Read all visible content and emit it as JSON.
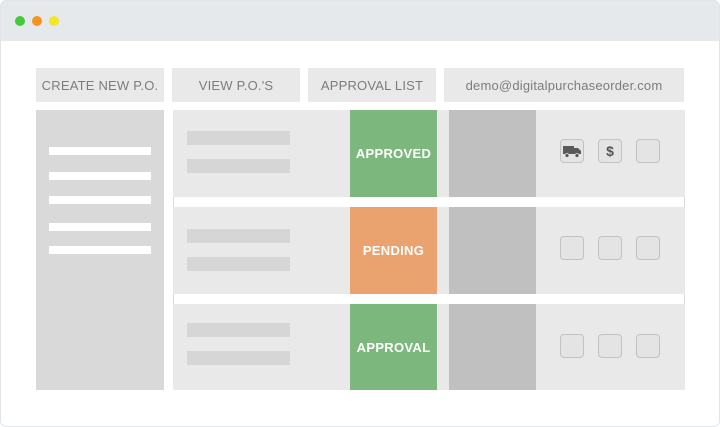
{
  "window": {
    "traffic_lights": [
      "green",
      "orange",
      "yellow"
    ]
  },
  "nav": {
    "create_label": "CREATE NEW P.O.",
    "view_label": "VIEW P.O.'S",
    "approval_label": "APPROVAL LIST",
    "email": "demo@digitalpurchaseorder.com"
  },
  "rows": [
    {
      "status": "APPROVED",
      "status_color": "#7cb87d",
      "icons": [
        "truck-icon",
        "dollar-icon",
        "empty"
      ]
    },
    {
      "status": "PENDING",
      "status_color": "#eaa36f",
      "icons": [
        "empty",
        "empty",
        "empty"
      ]
    },
    {
      "status": "APPROVAL",
      "status_color": "#7cb87d",
      "icons": [
        "empty",
        "empty",
        "empty"
      ]
    }
  ],
  "icons": {
    "dollar_glyph": "$"
  },
  "colors": {
    "green_status": "#7cb87d",
    "orange_status": "#eaa36f",
    "titlebar": "#e6e9ec"
  }
}
